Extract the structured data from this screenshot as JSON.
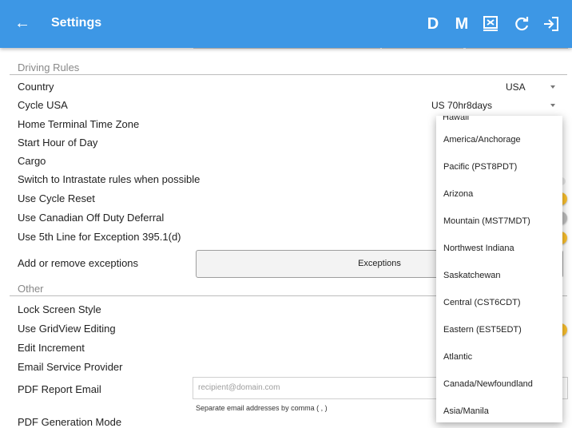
{
  "appbar": {
    "title": "Settings",
    "back_glyph": "←",
    "actions": [
      {
        "label": "D"
      },
      {
        "label": "M"
      }
    ],
    "icons": [
      "report-icon",
      "refresh-icon",
      "logout-icon"
    ],
    "bg_color": "#3d97e5"
  },
  "driving_rules": {
    "header": "Driving Rules",
    "rows": [
      {
        "label": "Country",
        "value": "USA"
      },
      {
        "label": "Cycle USA",
        "value": "US 70hr8days"
      },
      {
        "label": "Home Terminal Time Zone",
        "value": ""
      },
      {
        "label": "Start Hour of Day",
        "value": ""
      },
      {
        "label": "Cargo",
        "value": ""
      },
      {
        "label": "Switch to Intrastate rules when possible",
        "toggle": false
      },
      {
        "label": "Use Cycle Reset",
        "toggle": true
      },
      {
        "label": "Use Canadian Off Duty Deferral",
        "toggle": false
      },
      {
        "label": "Use 5th Line for Exception 395.1(d)",
        "toggle": true
      }
    ],
    "exceptions_label": "Add or remove exceptions",
    "exceptions_button": "Exceptions"
  },
  "other": {
    "header": "Other",
    "rows": [
      {
        "label": "Lock Screen Style"
      },
      {
        "label": "Use GridView Editing",
        "toggle": true
      },
      {
        "label": "Edit Increment"
      },
      {
        "label": "Email Service Provider"
      }
    ],
    "pdf_email_label": "PDF Report Email",
    "pdf_email_placeholder": "recipient@domain.com",
    "pdf_email_hint": "Separate email addresses by comma ( , )",
    "pdf_generation_label": "PDF Generation Mode"
  },
  "timezone_dropdown": {
    "cut_item": "Hawaii",
    "options": [
      "America/Anchorage",
      "Pacific (PST8PDT)",
      "Arizona",
      "Mountain (MST7MDT)",
      "Northwest Indiana",
      "Saskatchewan",
      "Central (CST6CDT)",
      "Eastern (EST5EDT)",
      "Atlantic",
      "Canada/Newfoundland",
      "Asia/Manila"
    ]
  },
  "colors": {
    "toggle_on": "#fbc02d",
    "toggle_off": "#bdbdbd"
  }
}
